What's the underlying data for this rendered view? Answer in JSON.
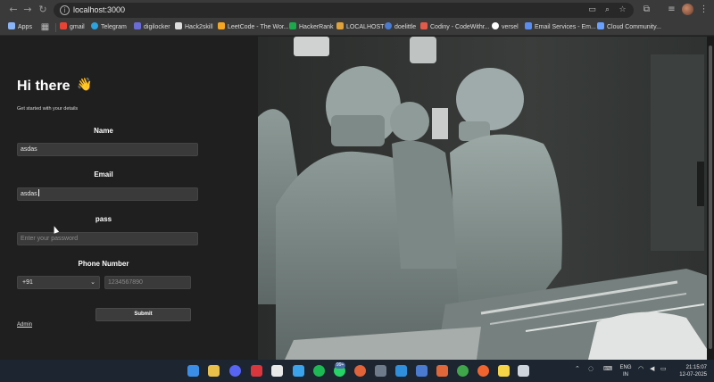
{
  "browser": {
    "url": "localhost:3000",
    "nav": {
      "back_icon": "←",
      "forward_icon": "→",
      "reload_icon": "↻"
    }
  },
  "bookmarks": [
    {
      "label": "Apps",
      "color": "#8ab4f8"
    },
    {
      "label": "gmail",
      "color": "#ea4335"
    },
    {
      "label": "Telegram",
      "color": "#2aa3df"
    },
    {
      "label": "digilocker",
      "color": "#6b6bd6"
    },
    {
      "label": "Hack2skill",
      "color": "#dddddd"
    },
    {
      "label": "LeetCode - The Wor...",
      "color": "#f5a623"
    },
    {
      "label": "HackerRank",
      "color": "#1ba94c"
    },
    {
      "label": "LOCALHOST",
      "color": "#e0a23a"
    },
    {
      "label": "doelittle",
      "color": "#4a7bd1"
    },
    {
      "label": "Codiny - CodeWithr...",
      "color": "#e25a4a"
    },
    {
      "label": "versel",
      "color": "#ffffff"
    },
    {
      "label": "Email Services - Em...",
      "color": "#5b8def"
    },
    {
      "label": "Cloud Community...",
      "color": "#6aa0ff"
    }
  ],
  "form": {
    "greeting": "Hi there",
    "wave_emoji": "👋",
    "subtitle": "Get started with your details",
    "name_label": "Name",
    "name_value": "asdas",
    "email_label": "Email",
    "email_value": "asdas",
    "pass_label": "pass",
    "pass_placeholder": "Enter your password",
    "phone_label": "Phone Number",
    "country_code": "+91",
    "phone_placeholder": "1234567890",
    "submit_label": "Submit",
    "admin_link": "Admin"
  },
  "taskbar": {
    "badge": "99+",
    "lang_top": "ENG",
    "lang_bottom": "IN",
    "time": "21:15:07",
    "date": "12-07-2025"
  }
}
